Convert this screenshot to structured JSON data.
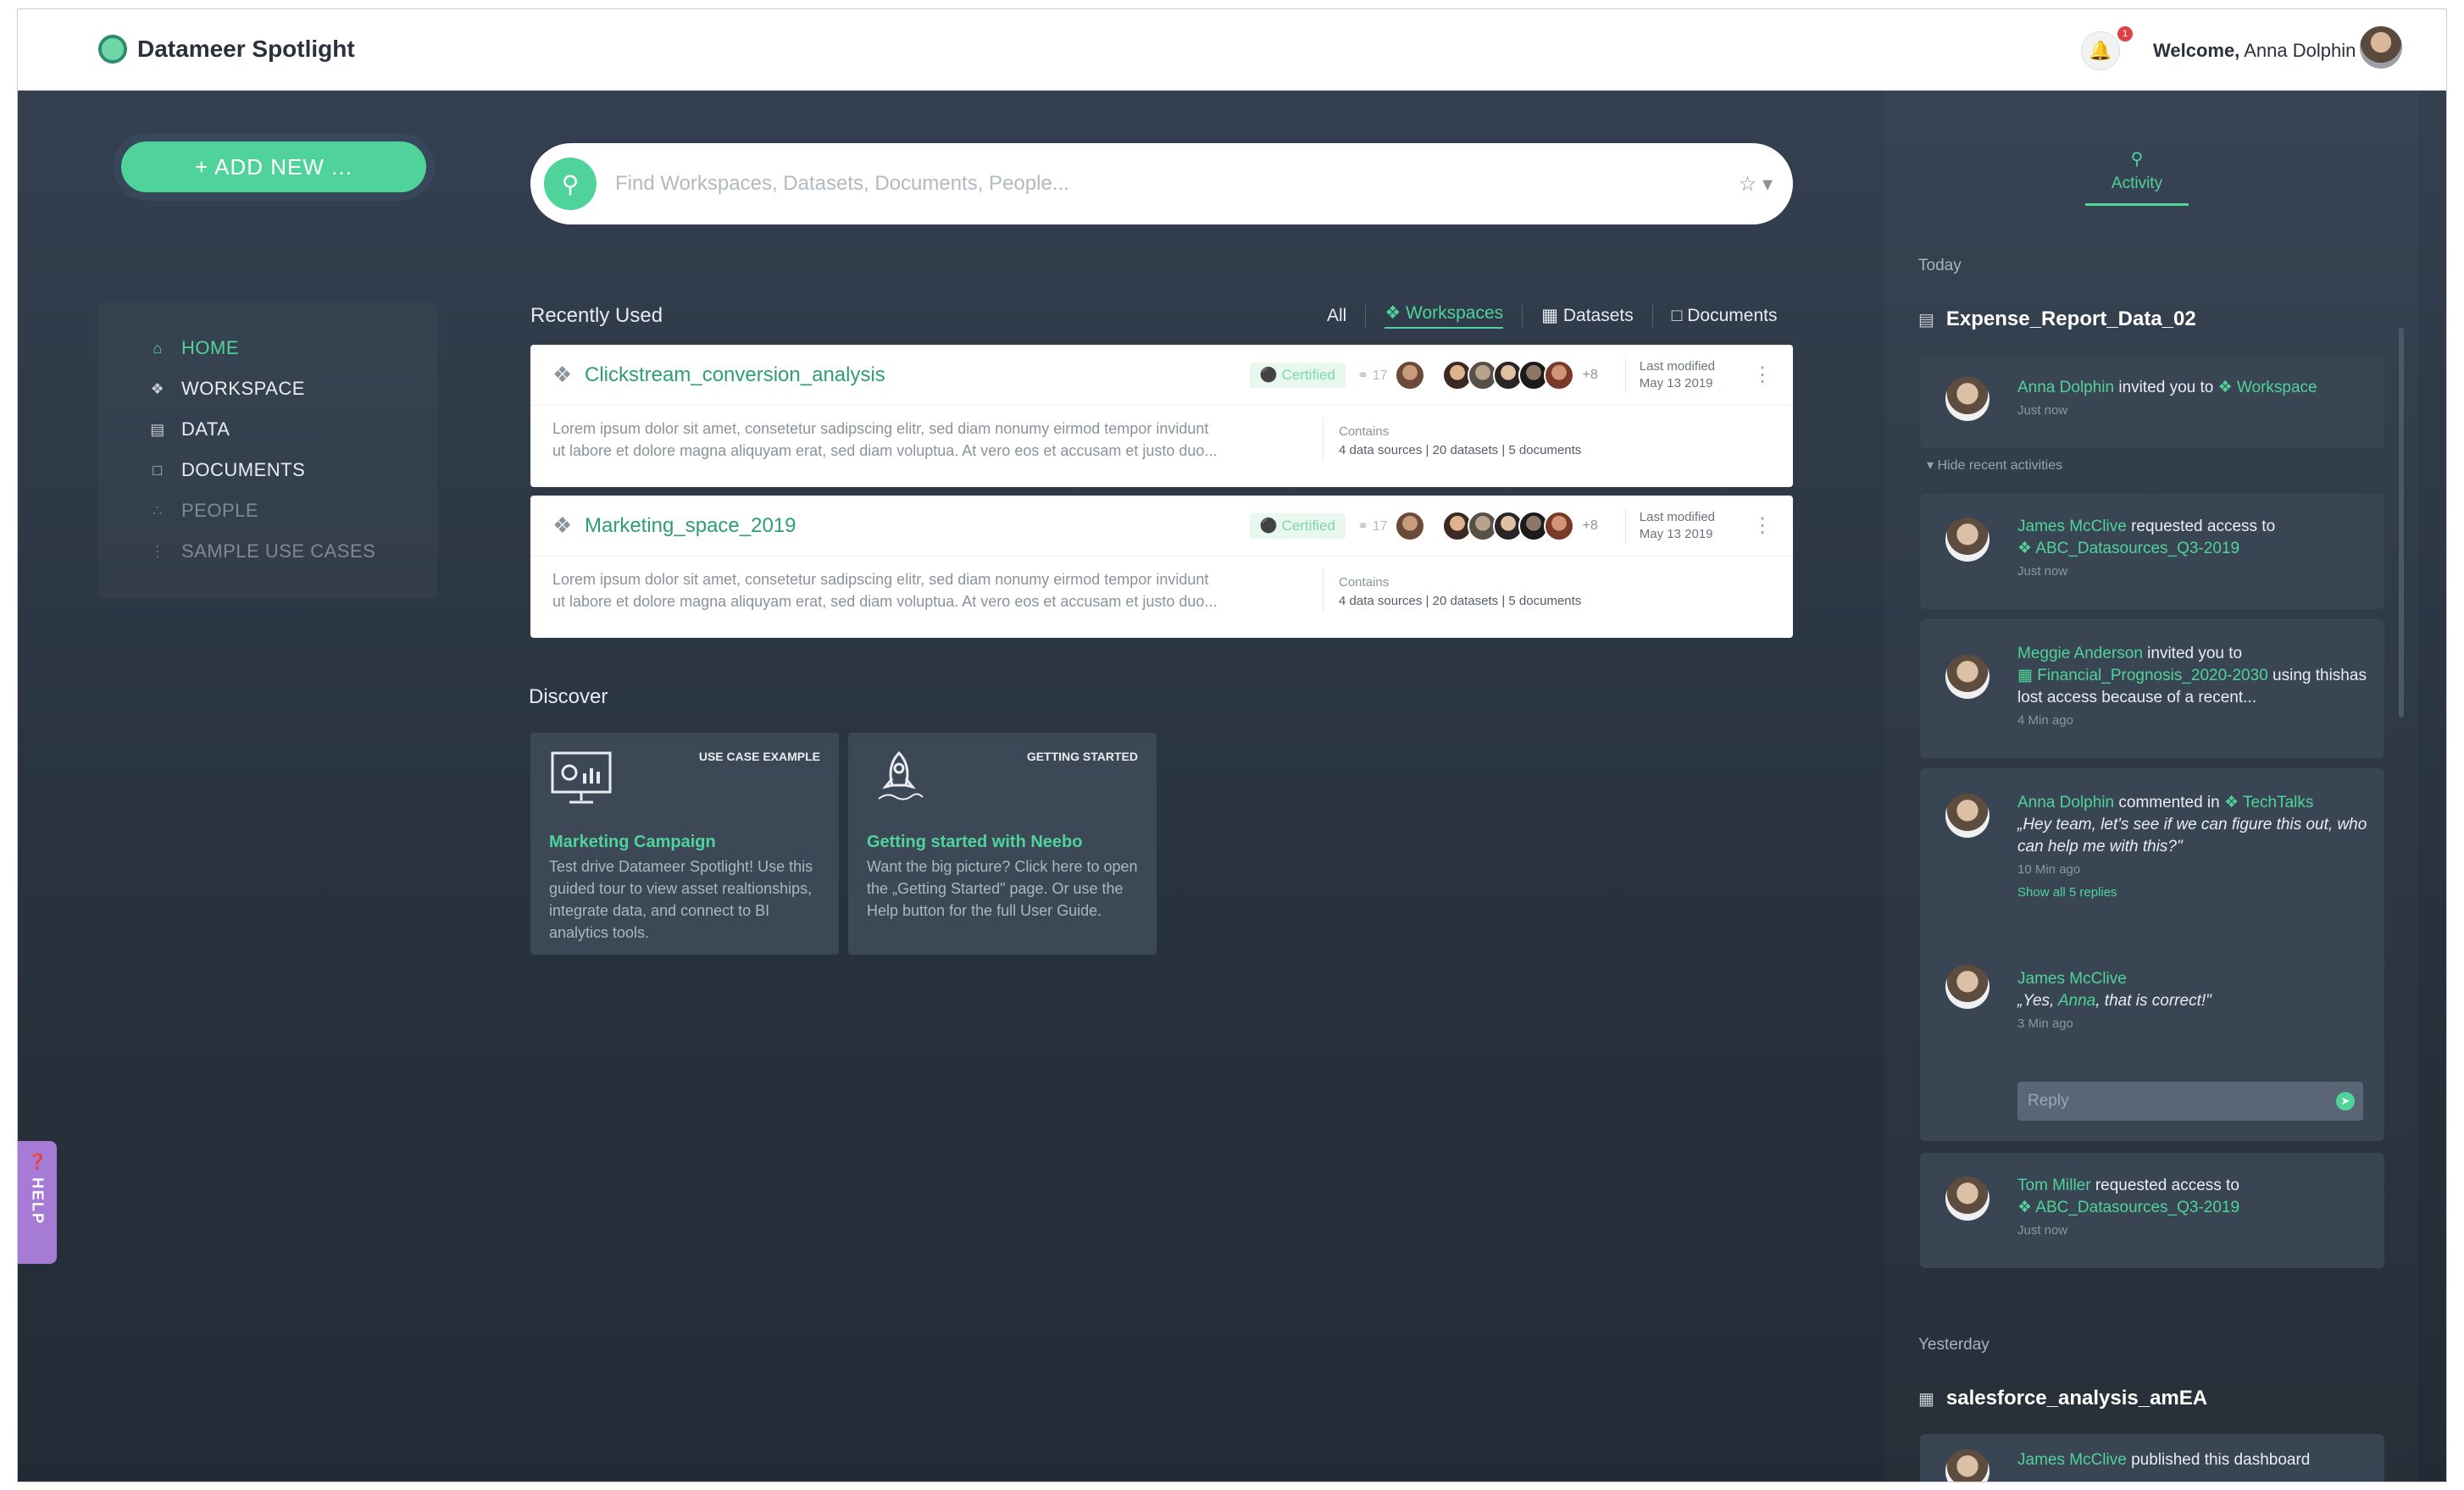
{
  "app": {
    "title": "Datameer Spotlight"
  },
  "header": {
    "welcome_prefix": "Welcome,",
    "user_name": "Anna Dolphin",
    "notification_count": "1"
  },
  "sidebar": {
    "add_new_label": "+ ADD NEW ...",
    "items": [
      {
        "label": "HOME"
      },
      {
        "label": "WORKSPACE"
      },
      {
        "label": "DATA"
      },
      {
        "label": "DOCUMENTS"
      },
      {
        "label": "PEOPLE"
      },
      {
        "label": "SAMPLE USE CASES"
      }
    ],
    "help_label": "HELP"
  },
  "search": {
    "placeholder": "Find Workspaces, Datasets, Documents, People..."
  },
  "recently_used": {
    "title": "Recently Used",
    "filters": {
      "all": "All",
      "workspaces": "Workspaces",
      "datasets": "Datasets",
      "documents": "Documents"
    },
    "cards": [
      {
        "name": "Clickstream_conversion_analysis",
        "badge": "Certified",
        "shares": "17",
        "more_users": "+8",
        "last_modified_label": "Last modified",
        "last_modified_date": "May 13 2019",
        "description_line1": "Lorem ipsum dolor sit amet, consetetur sadipscing elitr, sed diam nonumy eirmod tempor invidunt",
        "description_line2": "ut labore et dolore magna aliquyam erat, sed diam voluptua. At vero eos et accusam et justo duo...",
        "contains_label": "Contains",
        "contains_detail": "4 data sources  |  20 datasets  |  5 documents"
      },
      {
        "name": "Marketing_space_2019",
        "badge": "Certified",
        "shares": "17",
        "more_users": "+8",
        "last_modified_label": "Last modified",
        "last_modified_date": "May 13 2019",
        "description_line1": "Lorem ipsum dolor sit amet, consetetur sadipscing elitr, sed diam nonumy eirmod tempor invidunt",
        "description_line2": "ut labore et dolore magna aliquyam erat, sed diam voluptua. At vero eos et accusam et justo duo...",
        "contains_label": "Contains",
        "contains_detail": "4 data sources  |  20 datasets  |  5 documents"
      }
    ]
  },
  "discover": {
    "title": "Discover",
    "cards": [
      {
        "label": "USE CASE EXAMPLE",
        "title": "Marketing Campaign",
        "text": "Test drive Datameer Spotlight! Use this guided tour to view asset realtionships, integrate data, and connect to BI analytics tools."
      },
      {
        "label": "GETTING STARTED",
        "title": "Getting started with Neebo",
        "text": "Want the big picture? Click here to open the „Getting Started\" page. Or use the Help button for the full User Guide."
      }
    ]
  },
  "activity": {
    "tab_label": "Activity",
    "today_label": "Today",
    "group1": "Expense_Report_Data_02",
    "hide_recent": "Hide recent activities",
    "items": [
      {
        "name": "Anna Dolphin",
        "action": " invited you to ",
        "target": "Workspace",
        "time": "Just now"
      },
      {
        "name": "James McClive",
        "action": " requested access to",
        "target": "ABC_Datasources_Q3-2019",
        "time": "Just now"
      },
      {
        "name": "Meggie Anderson",
        "action": " invited you to",
        "target": "Financial_Prognosis_2020-2030",
        "suffix": " using thishas lost access because of a recent...",
        "time": "4 Min ago"
      },
      {
        "name": "Anna Dolphin",
        "action": " commented in ",
        "target": "TechTalks",
        "comment": "„Hey team, let's see if we can figure this out, who can help me with this?\"",
        "time": "10 Min ago",
        "replies": "Show all 5 replies"
      },
      {
        "name": "James McClive",
        "comment_prefix": "„Yes, ",
        "comment_name": "Anna",
        "comment_suffix": ", that is correct!\"",
        "time": "3 Min ago"
      },
      {
        "name": "Tom Miller",
        "action": " requested access to",
        "target": "ABC_Datasources_Q3-2019",
        "time": "Just now"
      }
    ],
    "reply_placeholder": "Reply",
    "yesterday_label": "Yesterday",
    "group2": "salesforce_analysis_amEA",
    "last_item": {
      "name": "James McClive",
      "action": " published this dashboard"
    }
  },
  "colors": {
    "accent": "#4fd39a",
    "background": "#2c3744",
    "card": "#ffffff",
    "help": "#a57bd6"
  },
  "icons": [
    "search-icon",
    "bell-icon",
    "star-icon",
    "home-icon",
    "workspace-icon",
    "data-icon",
    "documents-icon",
    "people-icon",
    "certified-icon",
    "pin-icon"
  ]
}
